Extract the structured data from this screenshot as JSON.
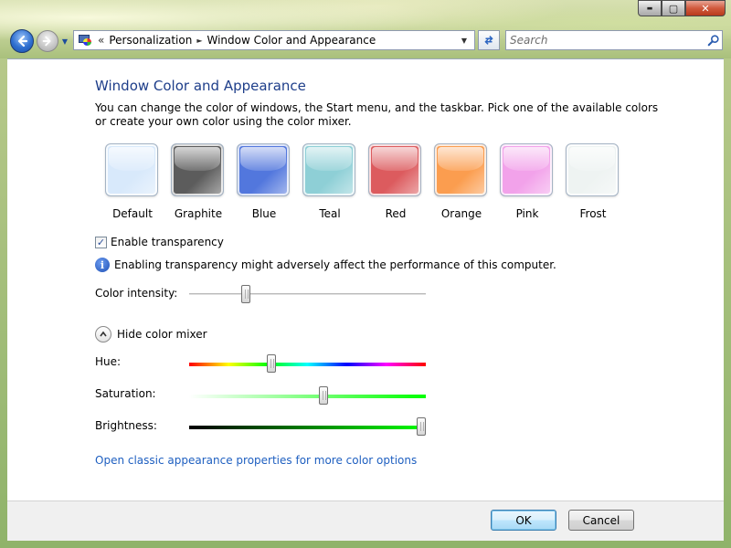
{
  "window": {
    "caption": {
      "minimize": "▬",
      "maximize": "▢",
      "close": "✕"
    }
  },
  "nav": {
    "breadcrumb": {
      "overflow": "«",
      "items": [
        "Personalization",
        "Window Color and Appearance"
      ],
      "separator": "►"
    },
    "search_placeholder": "Search"
  },
  "main": {
    "title": "Window Color and Appearance",
    "description": "You can change the color of windows, the Start menu, and the taskbar. Pick one of the available colors or create your own color using the color mixer.",
    "swatches": [
      {
        "label": "Default",
        "color": "#d8e9fb"
      },
      {
        "label": "Graphite",
        "color": "#5c5c5c"
      },
      {
        "label": "Blue",
        "color": "#5277dd"
      },
      {
        "label": "Teal",
        "color": "#8ecfd6"
      },
      {
        "label": "Red",
        "color": "#dc5b5e"
      },
      {
        "label": "Orange",
        "color": "#fb9d4f"
      },
      {
        "label": "Pink",
        "color": "#f2a2ea"
      },
      {
        "label": "Frost",
        "color": "#eef3f2"
      }
    ],
    "transparency": {
      "label": "Enable transparency",
      "checked": true
    },
    "info_text": "Enabling transparency might adversely affect the performance of this computer.",
    "color_intensity": {
      "label": "Color intensity:",
      "value": 0.23
    },
    "mixer_toggle_label": "Hide color mixer",
    "hue": {
      "label": "Hue:",
      "value": 0.34
    },
    "saturation": {
      "label": "Saturation:",
      "value": 0.57
    },
    "brightness": {
      "label": "Brightness:",
      "value": 1.0
    },
    "classic_link": "Open classic appearance properties for more color options"
  },
  "footer": {
    "ok_label": "OK",
    "cancel_label": "Cancel"
  },
  "colors": {
    "heading": "#1e3e8a",
    "link": "#1e5fc0"
  }
}
